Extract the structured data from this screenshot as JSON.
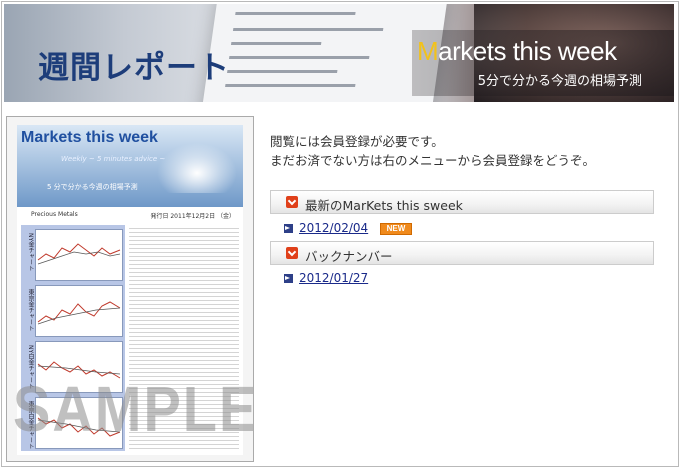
{
  "banner": {
    "title_jp": "週間レポート",
    "title_en_first": "M",
    "title_en_rest": "arkets this week",
    "subtitle": "5分で分かる今週の相場予測"
  },
  "sample": {
    "header_title": "Markets this week",
    "header_sub1": "Weekly ~ 5 minutes advice ~",
    "header_sub2": "5 分で分かる今週の相場予測",
    "meta_left": "Precious Metals",
    "meta_right": "発行日  2011年12月2日  （金）",
    "chart_labels": [
      "NY金チャート",
      "東京金チャート",
      "NY白金チャート",
      "東京白金チャート"
    ],
    "watermark": "SAMPLE"
  },
  "notice": {
    "line1": "閲覧には会員登録が必要です。",
    "line2": "まだお済でない方は右のメニューから会員登録をどうぞ。"
  },
  "sections": {
    "latest_label": "最新のMarKets this sweek",
    "latest_link": "2012/02/04",
    "new_badge": "NEW",
    "backnumber_label": "バックナンバー",
    "backnumber_link": "2012/01/27"
  },
  "colors": {
    "accent_red": "#e0401a",
    "link_blue": "#1a2a8a",
    "new_orange": "#f08a1c",
    "banner_title": "#1d3d7a"
  }
}
